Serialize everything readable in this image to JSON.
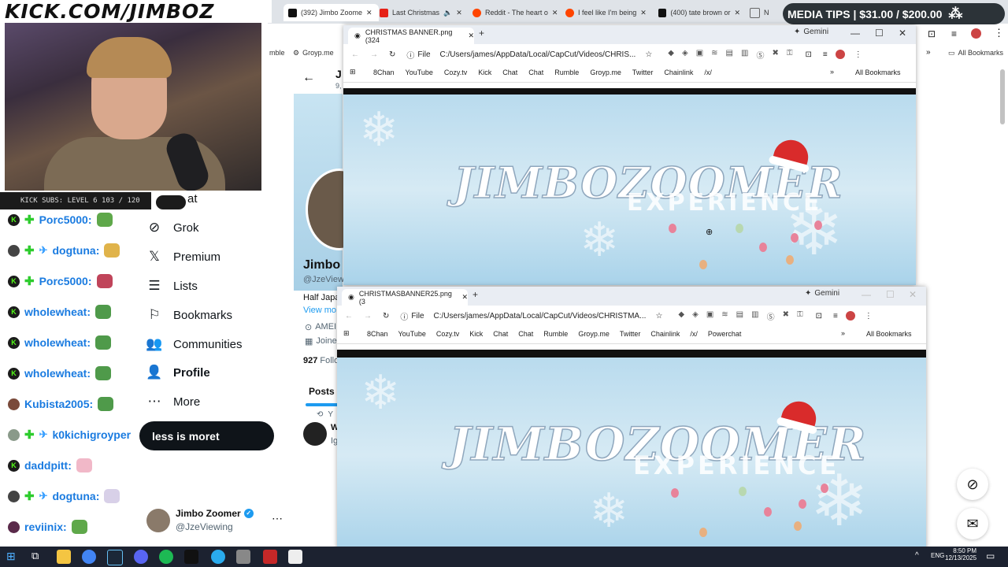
{
  "stream": {
    "logo": "KICK.COM/JIMBOZ",
    "subs": "KICK SUBS: LEVEL 6 103 / 120",
    "tips": "MEDIA TIPS | $31.00 / $200.00"
  },
  "back_browser": {
    "tabs": [
      {
        "label": "(392) Jimbo Zoome",
        "color": "#111111"
      },
      {
        "label": "Last Christmas",
        "color": "#e62117"
      },
      {
        "label": "Reddit - The heart o",
        "color": "#ff4500"
      },
      {
        "label": "I feel like I'm being",
        "color": "#ff4500"
      },
      {
        "label": "(400) tate brown or",
        "color": "#111111"
      },
      {
        "label": "N",
        "color": "#666666"
      }
    ],
    "bookmarks_partial": [
      "mble",
      "Groyp.me"
    ],
    "all_bookmarks": "All Bookmarks"
  },
  "x_page": {
    "nav": [
      {
        "label": "Grok",
        "icon": "grok-icon"
      },
      {
        "label": "Premium",
        "icon": "x-logo-icon"
      },
      {
        "label": "Lists",
        "icon": "list-icon"
      },
      {
        "label": "Bookmarks",
        "icon": "bookmark-icon"
      },
      {
        "label": "Communities",
        "icon": "communities-icon"
      },
      {
        "label": "Profile",
        "icon": "profile-icon"
      },
      {
        "label": "More",
        "icon": "more-icon"
      }
    ],
    "partial_nav": "at",
    "profile_name": "Jimbo Z",
    "profile_handle": "@JzeViewi",
    "bio": "Half Japa",
    "view_more": "View mo",
    "location": "AMEI",
    "joined": "Joine",
    "following_count": "927",
    "following_label": "Follo",
    "tab_posts": "Posts",
    "date_partial": "9,",
    "repost_partial": "Y",
    "tweet_author_partial": "W",
    "tweet_text_partial": "Ig",
    "account_name": "Jimbo Zoomer",
    "account_handle": "@JzeViewing",
    "post_button": "less is more",
    "caption": "less is moret"
  },
  "chat": [
    {
      "user": "Porc5000:",
      "badge": "kick",
      "emote": "#5fa84a"
    },
    {
      "user": "dogtuna:",
      "badge": "soccer",
      "emote": "#e0b34a"
    },
    {
      "user": "Porc5000:",
      "badge": "kick",
      "emote": "#c0445a"
    },
    {
      "user": "wholewheat:",
      "badge": "kick",
      "emote": "#4f9a4a"
    },
    {
      "user": "wholewheat:",
      "badge": "kick",
      "emote": "#4f9a4a"
    },
    {
      "user": "wholewheat:",
      "badge": "kick",
      "emote": "#4f9a4a"
    },
    {
      "user": "Kubista2005:",
      "badge": "avatar",
      "emote": "#4f9a4a"
    },
    {
      "user": "k0kichigroyper",
      "badge": "avatar2",
      "emote": ""
    },
    {
      "user": "daddpitt:",
      "badge": "kick",
      "emote": "#f1b8c8"
    },
    {
      "user": "dogtuna:",
      "badge": "soccer",
      "emote": "#d8d0e8"
    },
    {
      "user": "reviinix:",
      "badge": "avatar3",
      "emote": "#5fa84a"
    }
  ],
  "window1": {
    "tab_label": "CHRISTMAS BANNER.png (324",
    "gemini": "Gemini",
    "file_label": "File",
    "url": "C:/Users/james/AppData/Local/CapCut/Videos/CHRIS...",
    "bookmarks": [
      "8Chan",
      "YouTube",
      "Cozy.tv",
      "Kick",
      "Chat",
      "Chat",
      "Rumble",
      "Groyp.me",
      "Twitter",
      "Chainlink",
      "/x/"
    ],
    "all_bookmarks": "All Bookmarks",
    "banner_title": "JIMBOZOOMER",
    "banner_sub": "EXPERIENCE"
  },
  "window2": {
    "tab_label": "CHRISTMASBANNER25.png (3",
    "gemini": "Gemini",
    "file_label": "File",
    "url": "C:/Users/james/AppData/Local/CapCut/Videos/CHRISTMA...",
    "bookmarks": [
      "8Chan",
      "YouTube",
      "Cozy.tv",
      "Kick",
      "Chat",
      "Chat",
      "Rumble",
      "Groyp.me",
      "Twitter",
      "Chainlink",
      "/x/",
      "Powerchat"
    ],
    "all_bookmarks": "All Bookmarks",
    "banner_title": "JIMBOZOOMER",
    "banner_sub": "EXPERIENCE"
  },
  "taskbar": {
    "lang": "ENG",
    "time": "8:50 PM",
    "date": "12/13/2025"
  }
}
